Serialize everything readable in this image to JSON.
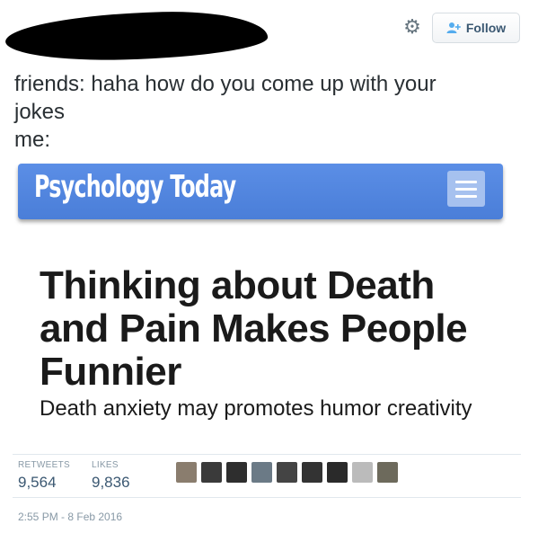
{
  "header": {
    "follow_label": "Follow",
    "gear_icon": "gear-icon",
    "follow_icon": "add-user-icon"
  },
  "tweet": {
    "lines": [
      "friends: haha how do you come up with your",
      "jokes",
      "me:"
    ]
  },
  "embedded_image": {
    "logo_text": "Psychology Today",
    "menu_icon": "hamburger-menu-icon",
    "header_color": "#4f83dd",
    "headline": "Thinking about Death and Pain Makes People Funnier",
    "subheadline": "Death anxiety may promotes humor creativity"
  },
  "stats": {
    "retweets_label": "RETWEETS",
    "retweets_value": "9,564",
    "likes_label": "LIKES",
    "likes_value": "9,836"
  },
  "likers": {
    "avatar_colors": [
      "#8a7d6e",
      "#3a3a3a",
      "#2e2e2e",
      "#6b7a86",
      "#444444",
      "#333333",
      "#2a2a2a",
      "#bbbbbb",
      "#6d6a5c"
    ]
  },
  "timestamp": "2:55 PM - 8 Feb 2016"
}
